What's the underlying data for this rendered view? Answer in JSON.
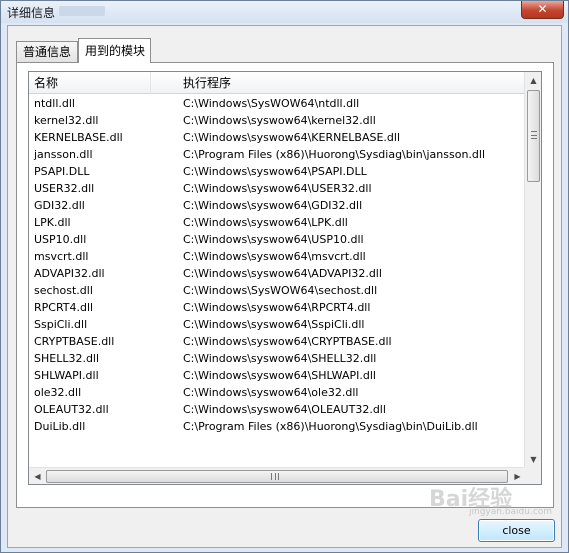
{
  "window": {
    "title": "详细信息",
    "close_glyph": "✕"
  },
  "tabs": [
    {
      "label": "普通信息"
    },
    {
      "label": "用到的模块"
    }
  ],
  "table": {
    "columns": [
      "名称",
      "执行程序"
    ],
    "rows": [
      [
        "ntdll.dll",
        "C:\\Windows\\SysWOW64\\ntdll.dll"
      ],
      [
        "kernel32.dll",
        "C:\\Windows\\syswow64\\kernel32.dll"
      ],
      [
        "KERNELBASE.dll",
        "C:\\Windows\\syswow64\\KERNELBASE.dll"
      ],
      [
        "jansson.dll",
        "C:\\Program Files (x86)\\Huorong\\Sysdiag\\bin\\jansson.dll"
      ],
      [
        "PSAPI.DLL",
        "C:\\Windows\\syswow64\\PSAPI.DLL"
      ],
      [
        "USER32.dll",
        "C:\\Windows\\syswow64\\USER32.dll"
      ],
      [
        "GDI32.dll",
        "C:\\Windows\\syswow64\\GDI32.dll"
      ],
      [
        "LPK.dll",
        "C:\\Windows\\syswow64\\LPK.dll"
      ],
      [
        "USP10.dll",
        "C:\\Windows\\syswow64\\USP10.dll"
      ],
      [
        "msvcrt.dll",
        "C:\\Windows\\syswow64\\msvcrt.dll"
      ],
      [
        "ADVAPI32.dll",
        "C:\\Windows\\syswow64\\ADVAPI32.dll"
      ],
      [
        "sechost.dll",
        "C:\\Windows\\SysWOW64\\sechost.dll"
      ],
      [
        "RPCRT4.dll",
        "C:\\Windows\\syswow64\\RPCRT4.dll"
      ],
      [
        "SspiCli.dll",
        "C:\\Windows\\syswow64\\SspiCli.dll"
      ],
      [
        "CRYPTBASE.dll",
        "C:\\Windows\\syswow64\\CRYPTBASE.dll"
      ],
      [
        "SHELL32.dll",
        "C:\\Windows\\syswow64\\SHELL32.dll"
      ],
      [
        "SHLWAPI.dll",
        "C:\\Windows\\syswow64\\SHLWAPI.dll"
      ],
      [
        "ole32.dll",
        "C:\\Windows\\syswow64\\ole32.dll"
      ],
      [
        "OLEAUT32.dll",
        "C:\\Windows\\syswow64\\OLEAUT32.dll"
      ],
      [
        "DuiLib.dll",
        "C:\\Program Files (x86)\\Huorong\\Sysdiag\\bin\\DuiLib.dll"
      ]
    ]
  },
  "scrollbar": {
    "up": "▲",
    "down": "▼",
    "left": "◀",
    "right": "▶"
  },
  "buttons": {
    "close": "close"
  },
  "watermark": {
    "text": "Bai经验",
    "sub": "jingyan.baidu.com"
  }
}
